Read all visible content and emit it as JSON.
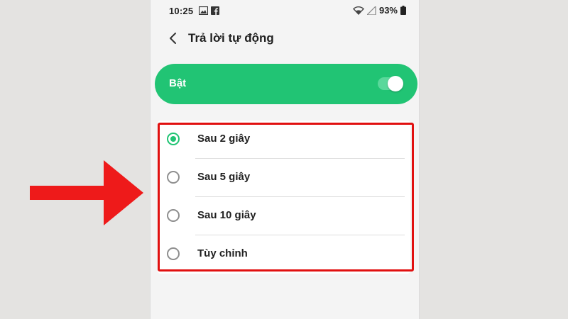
{
  "status_bar": {
    "time": "10:25",
    "battery": "93%",
    "icons": [
      "image-icon",
      "facebook-icon",
      "wifi-icon",
      "signal-icon",
      "battery-icon"
    ]
  },
  "header": {
    "title": "Trả lời tự động",
    "back_icon": "chevron-left-icon"
  },
  "master_toggle": {
    "label": "Bật",
    "on": true
  },
  "options": [
    {
      "label": "Sau 2 giây",
      "checked": true
    },
    {
      "label": "Sau 5 giây",
      "checked": false
    },
    {
      "label": "Sau 10 giây",
      "checked": false
    },
    {
      "label": "Tùy chỉnh",
      "checked": false
    }
  ],
  "colors": {
    "accent": "#21c474",
    "annotation": "#e11010",
    "background": "#e4e3e1"
  }
}
